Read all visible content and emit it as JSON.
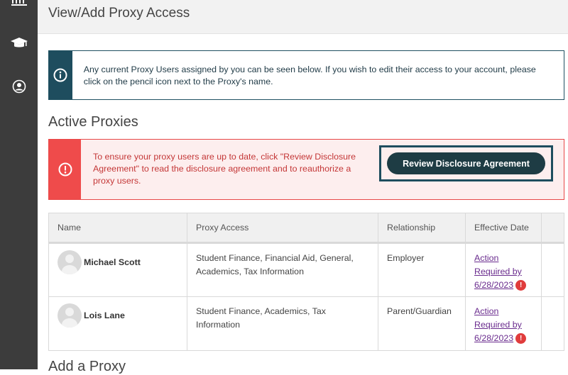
{
  "header": {
    "title": "View/Add Proxy Access"
  },
  "sidebar": {
    "items": [
      {
        "icon": "building-icon"
      },
      {
        "icon": "graduation-cap-icon"
      },
      {
        "icon": "user-icon"
      }
    ]
  },
  "info": {
    "text": "Any current Proxy Users assigned by you can be seen below. If you wish to edit their access to your account, please click on the pencil icon next to the Proxy's name."
  },
  "active_title": "Active Proxies",
  "alert": {
    "lines": [
      "To ensure your proxy users are up to date, click \"Review Disclosure",
      "Agreement\" to read the disclosure agreement and to reauthorize a",
      "proxy users."
    ],
    "button": "Review Disclosure Agreement"
  },
  "table": {
    "headers": [
      "Name",
      "Proxy Access",
      "Relationship",
      "Effective Date"
    ],
    "rows": [
      {
        "name": "Michael Scott",
        "access": "Student Finance, Financial Aid, General, Academics, Tax Information",
        "relationship": "Employer",
        "date_lines": [
          "Action",
          "Required by",
          "6/28/2023"
        ]
      },
      {
        "name": "Lois Lane",
        "access": "Student Finance, Academics, Tax Information",
        "relationship": "Parent/Guardian",
        "date_lines": [
          "Action",
          "Required by",
          "6/28/2023"
        ]
      }
    ]
  },
  "add_title": "Add a Proxy"
}
